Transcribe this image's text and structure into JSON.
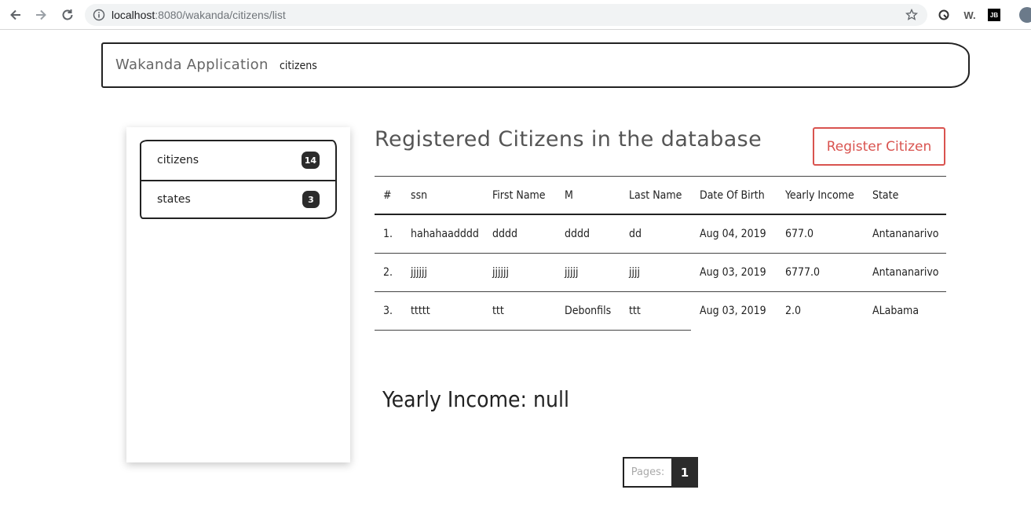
{
  "browser": {
    "url_host": "localhost",
    "url_rest": ":8080/wakanda/citizens/list",
    "extensions": {
      "w_label": "W.",
      "jb_label": "JB"
    }
  },
  "navbar": {
    "brand": "Wakanda Application",
    "link": "citizens"
  },
  "sidebar": {
    "items": [
      {
        "label": "citizens",
        "count": "14"
      },
      {
        "label": "states",
        "count": "3"
      }
    ]
  },
  "main": {
    "title": "Registered Citizens in the database",
    "register_button": "Register Citizen",
    "table": {
      "headers": [
        "#",
        "ssn",
        "First Name",
        "M",
        "Last Name",
        "Date Of Birth",
        "Yearly Income",
        "State"
      ],
      "rows": [
        [
          "1.",
          "hahahaadddd",
          "dddd",
          "dddd",
          "dd",
          "Aug 04, 2019",
          "677.0",
          "Antananarivo"
        ],
        [
          "2.",
          "jjjjjj",
          "jjjjjj",
          "jjjjj",
          "jjjj",
          "Aug 03, 2019",
          "6777.0",
          "Antananarivo"
        ],
        [
          "3.",
          "ttttt",
          "ttt",
          "Debonfils",
          "ttt",
          "Aug 03, 2019",
          "2.0",
          "ALabama"
        ]
      ]
    },
    "income_summary": "Yearly Income: null",
    "pagination": {
      "label": "Pages:",
      "current": "1"
    }
  }
}
